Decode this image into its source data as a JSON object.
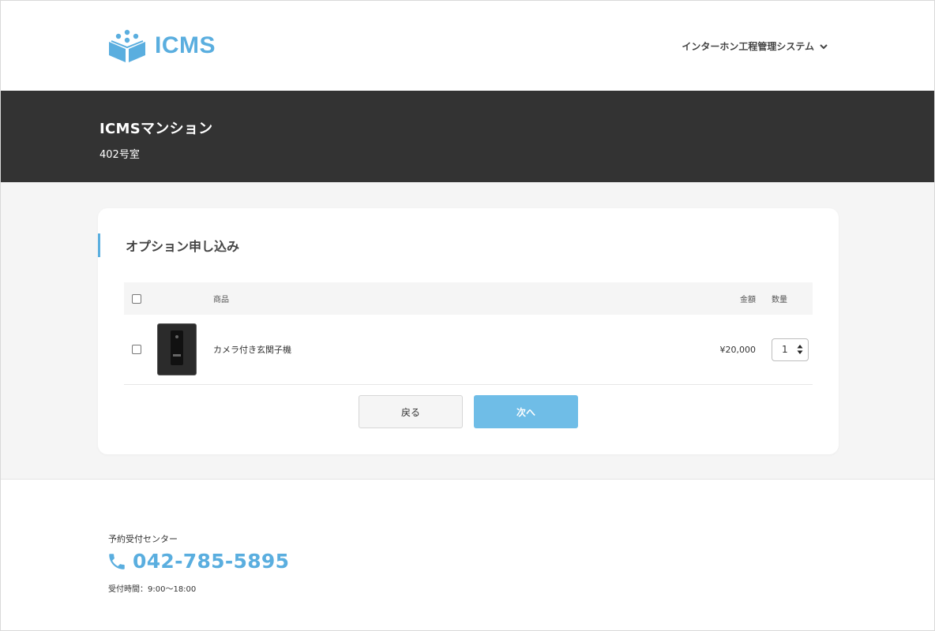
{
  "header": {
    "logo_text": "ICMS",
    "system_menu_label": "インターホン工程管理システム"
  },
  "band": {
    "building": "ICMSマンション",
    "room": "402号室"
  },
  "card": {
    "title": "オプション申し込み",
    "table": {
      "headers": {
        "product": "商品",
        "price": "金額",
        "qty": "数量"
      },
      "rows": [
        {
          "name": "カメラ付き玄関子機",
          "price": "¥20,000",
          "qty": "1"
        }
      ]
    },
    "buttons": {
      "back": "戻る",
      "next": "次へ"
    }
  },
  "footer": {
    "center_label": "予約受付センター",
    "phone": "042-785-5895",
    "hours": "受付時間：9:00〜18:00"
  },
  "colors": {
    "accent": "#5aaedf",
    "next_button": "#6fbde7",
    "band": "#333333",
    "main_bg": "#f5f5f5"
  },
  "icons": {
    "logo": "cube-logo-icon",
    "menu": "chevron-down-icon",
    "phone": "phone-icon"
  }
}
